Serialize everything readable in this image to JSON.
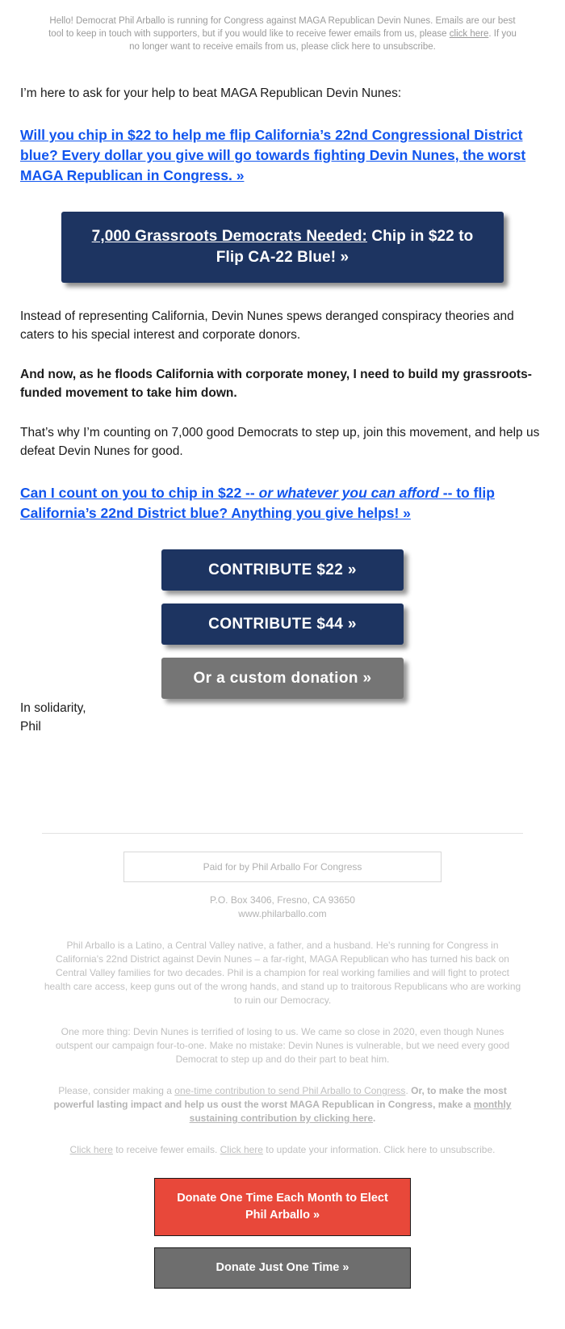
{
  "preheader": {
    "text_1": "Hello! Democrat Phil Arballo is running for Congress against MAGA Republican Devin Nunes. Emails are our best tool to keep in touch with supporters, but if you would like to receive fewer emails from us, please ",
    "link_1": "click here",
    "text_2": ". If you no longer want to receive emails from us, please click here to unsubscribe."
  },
  "body": {
    "intro": "I’m here to ask for your help to beat MAGA Republican Devin Nunes:",
    "link_1": "Will you chip in $22 to help me flip California’s 22nd Congressional District blue? Every dollar you give will go towards fighting Devin Nunes, the worst MAGA Republican in Congress. »",
    "cta_wide_underlined": "7,000 Grassroots Democrats Needed:",
    "cta_wide_rest": " Chip in $22 to Flip CA-22 Blue! »",
    "para_1": "Instead of representing California, Devin Nunes spews deranged conspiracy theories and caters to his special interest and corporate donors.",
    "para_2_bold": "And now, as he floods California with corporate money, I need to build my grassroots-funded movement to take him down.",
    "para_3": "That’s why I’m counting on 7,000 good Democrats to step up, join this movement, and help us defeat Devin Nunes for good.",
    "link_2_part_1": "Can I count on you to chip in $22 -- ",
    "link_2_italic": "or whatever you can afford",
    "link_2_part_2": " -- to flip California’s 22nd District blue? Anything you give helps! »",
    "signoff": "In solidarity,",
    "signoff_name": "Phil"
  },
  "donate_buttons": [
    {
      "label": "CONTRIBUTE $22 »",
      "style": "navy"
    },
    {
      "label": "CONTRIBUTE $44 »",
      "style": "navy"
    },
    {
      "label": "Or a custom donation »",
      "style": "gray"
    }
  ],
  "footer": {
    "paid_for": "Paid for by Phil Arballo For Congress",
    "address": "P.O. Box 3406, Fresno, CA 93650",
    "website": "www.philarballo.com",
    "bio": "Phil Arballo is a Latino, a Central Valley native, a father, and a husband. He's running for Congress in California's 22nd District against Devin Nunes – a far-right, MAGA Republican who has turned his back on Central Valley families for two decades. Phil is a champion for real working families and will fight to protect health care access, keep guns out of the wrong hands, and stand up to traitorous Republicans who are working to ruin our Democracy.",
    "one_more_thing": "One more thing: Devin Nunes is terrified of losing to us. We came so close in 2020, even though Nunes outspent our campaign four-to-one. Make no mistake: Devin Nunes is vulnerable, but we need every good Democrat to step up and do their part to beat him.",
    "ask_text_1": "Please, consider making a ",
    "ask_link_1": "one-time contribution to send Phil Arballo to Congress",
    "ask_text_2": ". ",
    "ask_bold": "Or, to make the most powerful lasting impact and help us oust the worst MAGA Republican in Congress, make a ",
    "ask_bold_link": "monthly sustaining contribution by clicking here",
    "ask_text_3": ".",
    "links_1": "Click here",
    "links_text_1": " to receive fewer emails. ",
    "links_2": "Click here",
    "links_text_2": " to update your information. Click here to unsubscribe.",
    "buttons": [
      {
        "label": "Donate One Time Each Month to Elect Phil Arballo »",
        "style": "red"
      },
      {
        "label": "Donate Just One Time »",
        "style": "gray"
      }
    ]
  },
  "colors": {
    "navy": "#1d3461",
    "link_blue": "#1155ee",
    "red": "#e8483a",
    "gray_button": "#757575",
    "footer_text": "#b8b8b8"
  }
}
